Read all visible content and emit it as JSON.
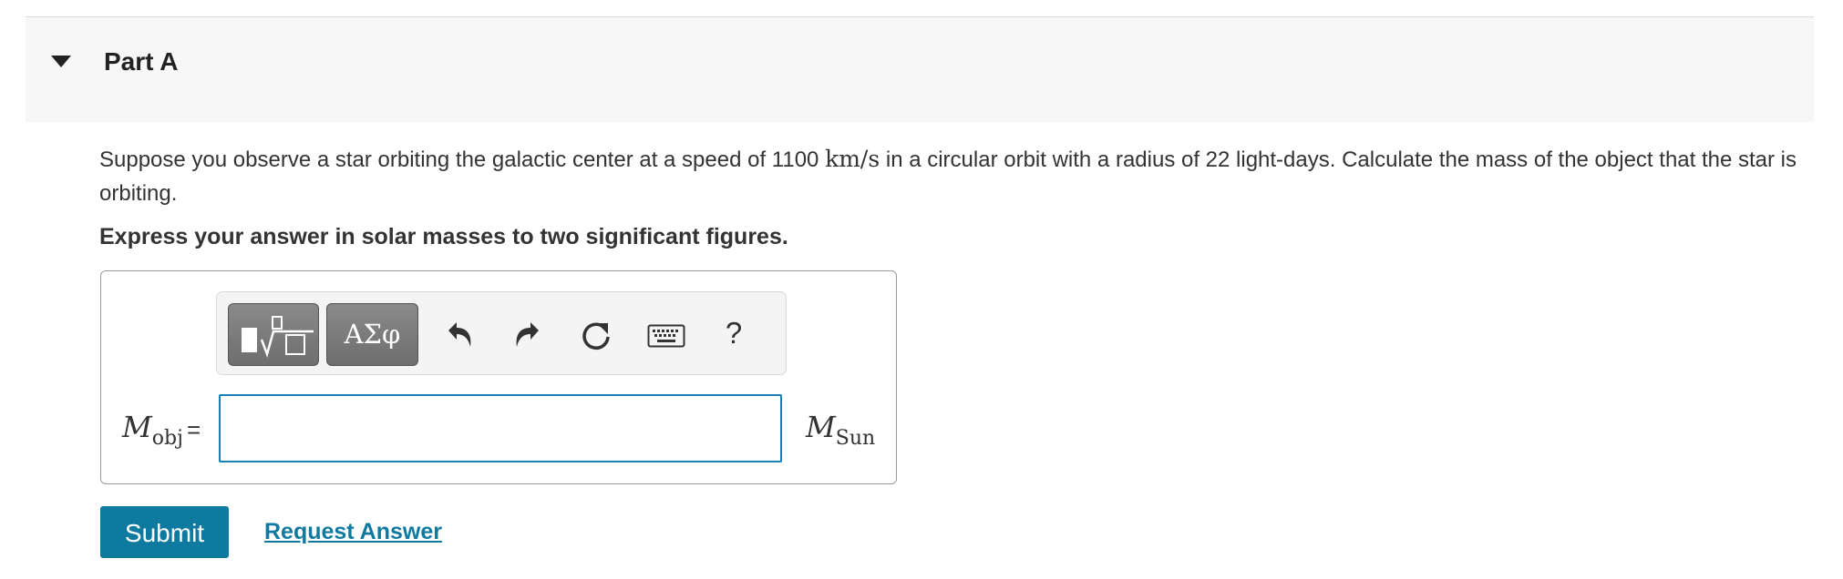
{
  "part": {
    "title": "Part A"
  },
  "question": {
    "text_before": "Suppose you observe a star orbiting the galactic center at a speed of 1100 ",
    "unit": "km/s",
    "text_after": " in a circular orbit with a radius of 22 light-days. Calculate the mass of the object that the star is orbiting.",
    "instruction": "Express your answer in solar masses to two significant figures."
  },
  "toolbar": {
    "greek_label": "ΑΣφ",
    "help_label": "?",
    "icons": [
      "templates-icon",
      "greek-letters-icon",
      "undo-icon",
      "redo-icon",
      "reset-icon",
      "keyboard-icon",
      "help-icon"
    ]
  },
  "answer": {
    "variable": "M",
    "variable_sub": "obj",
    "equals": "=",
    "value": "",
    "unit": "M",
    "unit_sub": "Sun"
  },
  "actions": {
    "submit_label": "Submit",
    "request_label": "Request Answer"
  },
  "colors": {
    "accent": "#0f7aa0",
    "input_border": "#1a81b5",
    "header_bg": "#f7f7f7"
  }
}
